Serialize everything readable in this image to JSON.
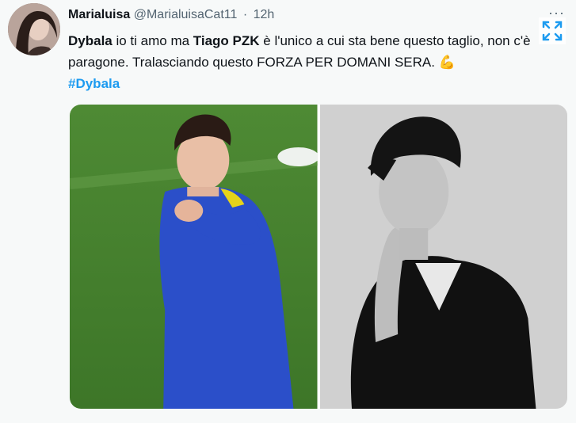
{
  "tweet": {
    "author_name": "Marialuisa",
    "author_handle": "@MarialuisaCat11",
    "separator": "·",
    "timestamp": "12h",
    "more_label": "···",
    "text": {
      "part1_bold": "Dybala",
      "part2": " io ti amo ma ",
      "part3_bold": "Tiago PZK",
      "part4": " è l'unico a cui sta bene questo taglio, non c'è paragone. Tralasciando questo FORZA PER DOMANI SERA. ",
      "emoji": "💪"
    },
    "hashtag": "#Dybala",
    "media": [
      {
        "icon": "photo-football-player"
      },
      {
        "icon": "photo-man-black-white"
      }
    ]
  },
  "colors": {
    "accent": "#1d9bf0",
    "text": "#0f1419",
    "secondary": "#536471"
  }
}
